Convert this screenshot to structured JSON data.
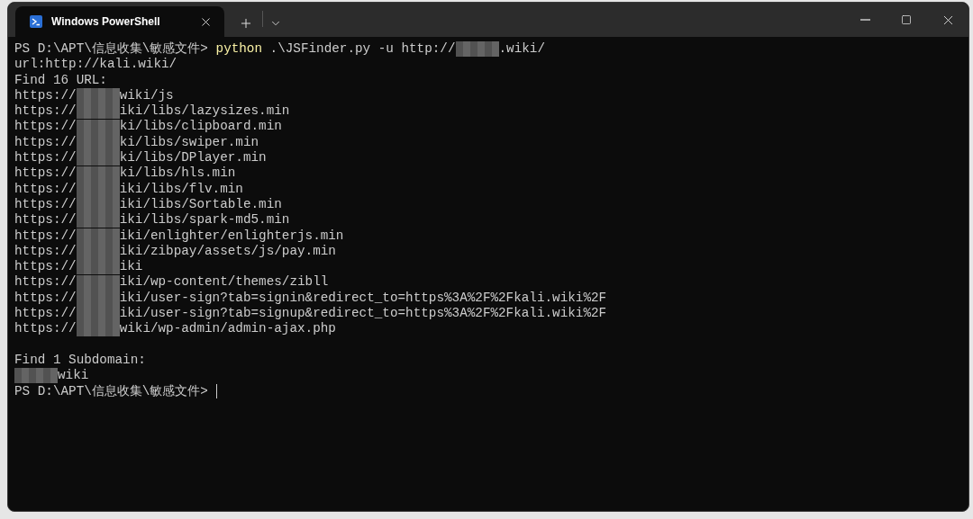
{
  "window": {
    "tabs": [
      {
        "title": "Windows PowerShell",
        "selected": true
      }
    ]
  },
  "terminal": {
    "lines": [
      {
        "kind": "output",
        "segments": [
          {
            "kind": "text",
            "text": "PS D:\\APT\\信息收集\\敏感文件> "
          },
          {
            "kind": "command",
            "text": "python"
          },
          {
            "kind": "text",
            "text": " .\\JSFinder.py -u http://"
          },
          {
            "kind": "blur"
          },
          {
            "kind": "text",
            "text": ".wiki/"
          }
        ]
      },
      {
        "kind": "output",
        "segments": [
          {
            "kind": "text",
            "text": "url:http://kali.wiki/"
          }
        ]
      },
      {
        "kind": "output",
        "segments": [
          {
            "kind": "text",
            "text": "Find 16 URL:"
          }
        ]
      },
      {
        "kind": "output",
        "segments": [
          {
            "kind": "text",
            "text": "https://"
          },
          {
            "kind": "blur"
          },
          {
            "kind": "text",
            "text": "wiki/js"
          }
        ]
      },
      {
        "kind": "output",
        "segments": [
          {
            "kind": "text",
            "text": "https://"
          },
          {
            "kind": "blur"
          },
          {
            "kind": "text",
            "text": "iki/libs/lazysizes.min"
          }
        ]
      },
      {
        "kind": "output",
        "segments": [
          {
            "kind": "text",
            "text": "https://"
          },
          {
            "kind": "blur"
          },
          {
            "kind": "text",
            "text": "ki/libs/clipboard.min"
          }
        ]
      },
      {
        "kind": "output",
        "segments": [
          {
            "kind": "text",
            "text": "https://"
          },
          {
            "kind": "blur"
          },
          {
            "kind": "text",
            "text": "ki/libs/swiper.min"
          }
        ]
      },
      {
        "kind": "output",
        "segments": [
          {
            "kind": "text",
            "text": "https://"
          },
          {
            "kind": "blur"
          },
          {
            "kind": "text",
            "text": "ki/libs/DPlayer.min"
          }
        ]
      },
      {
        "kind": "output",
        "segments": [
          {
            "kind": "text",
            "text": "https://"
          },
          {
            "kind": "blur"
          },
          {
            "kind": "text",
            "text": "ki/libs/hls.min"
          }
        ]
      },
      {
        "kind": "output",
        "segments": [
          {
            "kind": "text",
            "text": "https://"
          },
          {
            "kind": "blur"
          },
          {
            "kind": "text",
            "text": "iki/libs/flv.min"
          }
        ]
      },
      {
        "kind": "output",
        "segments": [
          {
            "kind": "text",
            "text": "https://"
          },
          {
            "kind": "blur"
          },
          {
            "kind": "text",
            "text": "iki/libs/Sortable.min"
          }
        ]
      },
      {
        "kind": "output",
        "segments": [
          {
            "kind": "text",
            "text": "https://"
          },
          {
            "kind": "blur"
          },
          {
            "kind": "text",
            "text": "iki/libs/spark-md5.min"
          }
        ]
      },
      {
        "kind": "output",
        "segments": [
          {
            "kind": "text",
            "text": "https://"
          },
          {
            "kind": "blur"
          },
          {
            "kind": "text",
            "text": "iki/enlighter/enlighterjs.min"
          }
        ]
      },
      {
        "kind": "output",
        "segments": [
          {
            "kind": "text",
            "text": "https://"
          },
          {
            "kind": "blur"
          },
          {
            "kind": "text",
            "text": "iki/zibpay/assets/js/pay.min"
          }
        ]
      },
      {
        "kind": "output",
        "segments": [
          {
            "kind": "text",
            "text": "https://"
          },
          {
            "kind": "blur"
          },
          {
            "kind": "text",
            "text": "iki"
          }
        ]
      },
      {
        "kind": "output",
        "segments": [
          {
            "kind": "text",
            "text": "https://"
          },
          {
            "kind": "blur"
          },
          {
            "kind": "text",
            "text": "iki/wp-content/themes/zibll"
          }
        ]
      },
      {
        "kind": "output",
        "segments": [
          {
            "kind": "text",
            "text": "https://"
          },
          {
            "kind": "blur"
          },
          {
            "kind": "text",
            "text": "iki/user-sign?tab=signin&redirect_to=https%3A%2F%2Fkali.wiki%2F"
          }
        ]
      },
      {
        "kind": "output",
        "segments": [
          {
            "kind": "text",
            "text": "https://"
          },
          {
            "kind": "blur"
          },
          {
            "kind": "text",
            "text": "iki/user-sign?tab=signup&redirect_to=https%3A%2F%2Fkali.wiki%2F"
          }
        ]
      },
      {
        "kind": "output",
        "segments": [
          {
            "kind": "text",
            "text": "https://"
          },
          {
            "kind": "blur"
          },
          {
            "kind": "text",
            "text": "wiki/wp-admin/admin-ajax.php"
          }
        ]
      },
      {
        "kind": "blank"
      },
      {
        "kind": "output",
        "segments": [
          {
            "kind": "text",
            "text": "Find 1 Subdomain:"
          }
        ]
      },
      {
        "kind": "output",
        "segments": [
          {
            "kind": "blur"
          },
          {
            "kind": "text",
            "text": "wiki"
          }
        ]
      },
      {
        "kind": "prompt",
        "segments": [
          {
            "kind": "text",
            "text": "PS D:\\APT\\信息收集\\敏感文件> "
          }
        ]
      }
    ]
  }
}
